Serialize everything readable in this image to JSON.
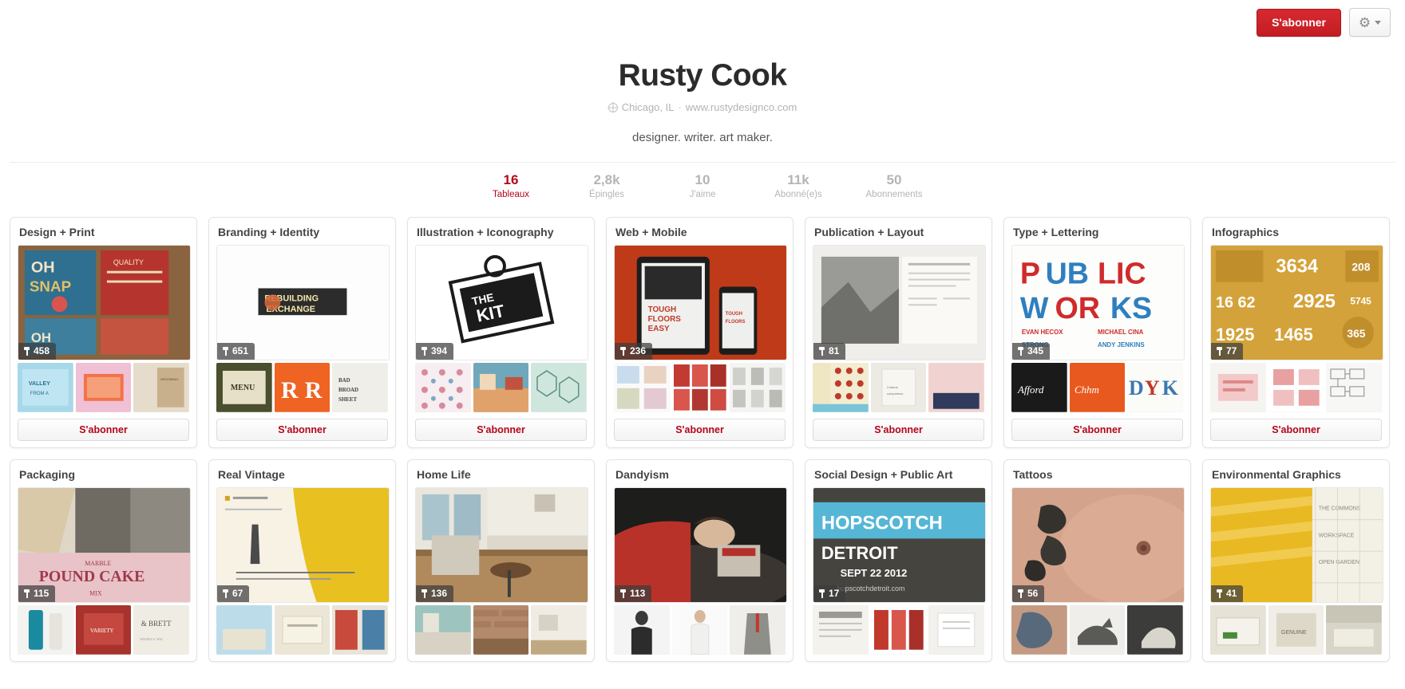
{
  "header": {
    "follow_button": "S'abonner",
    "settings_icon": "gear-icon",
    "settings_caret": "chevron-down-icon"
  },
  "profile": {
    "name": "Rusty Cook",
    "location": "Chicago, IL",
    "meta_separator": "·",
    "website": "www.rustydesignco.com",
    "bio": "designer. writer. art maker.",
    "avatar_alt": "avatar"
  },
  "stats": [
    {
      "value": "16",
      "label": "Tableaux",
      "active": true
    },
    {
      "value": "2,8k",
      "label": "Épingles",
      "active": false
    },
    {
      "value": "10",
      "label": "J'aime",
      "active": false
    },
    {
      "value": "11k",
      "label": "Abonné(e)s",
      "active": false
    },
    {
      "value": "50",
      "label": "Abonnements",
      "active": false
    }
  ],
  "board_follow_label": "S'abonner",
  "boards": [
    {
      "title": "Design + Print",
      "pins": "458",
      "cover": "poster-collage-orange",
      "thumbs": [
        "thumb-valley-blue",
        "thumb-pink-book",
        "thumb-tan-poster"
      ]
    },
    {
      "title": "Branding + Identity",
      "pins": "651",
      "cover": "rebuilding-exchange-logo",
      "thumbs": [
        "thumb-menu-dark",
        "thumb-orange-r",
        "thumb-broadsheet"
      ]
    },
    {
      "title": "Illustration + Iconography",
      "pins": "394",
      "cover": "the-kit-badge",
      "thumbs": [
        "thumb-floral-pattern",
        "thumb-interior-illo",
        "thumb-geo-mint"
      ]
    },
    {
      "title": "Web + Mobile",
      "pins": "236",
      "cover": "tablet-phone-red",
      "thumbs": [
        "thumb-ui-grid",
        "thumb-red-fashion",
        "thumb-product-grid"
      ]
    },
    {
      "title": "Publication + Layout",
      "pins": "81",
      "cover": "magazine-spread-bw",
      "thumbs": [
        "thumb-dot-grid",
        "thumb-book-cover",
        "thumb-pink-spread"
      ]
    },
    {
      "title": "Type + Lettering",
      "pins": "345",
      "cover": "public-works-type",
      "thumbs": [
        "thumb-afford-black",
        "thumb-orange-script",
        "thumb-dyk-letters"
      ]
    },
    {
      "title": "Infographics",
      "pins": "77",
      "cover": "gold-infographic-numbers",
      "thumbs": [
        "thumb-info-pink",
        "thumb-info-chart",
        "thumb-info-diagram"
      ]
    },
    {
      "title": "Packaging",
      "pins": "115",
      "cover": "pound-cake-package",
      "thumbs": [
        "thumb-teal-bottle",
        "thumb-red-tin",
        "thumb-wedding-label"
      ]
    },
    {
      "title": "Real Vintage",
      "pins": "67",
      "cover": "yellow-vintage-ad",
      "thumbs": [
        "thumb-blue-vintage",
        "thumb-cream-card",
        "thumb-retro-print"
      ]
    },
    {
      "title": "Home Life",
      "pins": "136",
      "cover": "dining-room-interior",
      "thumbs": [
        "thumb-teal-kitchen",
        "thumb-brick-room",
        "thumb-white-desk"
      ]
    },
    {
      "title": "Dandyism",
      "pins": "113",
      "cover": "man-reading-red",
      "thumbs": [
        "thumb-man-bw",
        "thumb-man-white",
        "thumb-suit-grey"
      ]
    },
    {
      "title": "Social Design + Public Art",
      "pins": "17",
      "cover": "hopscotch-detroit",
      "thumbs": [
        "thumb-poster-text",
        "thumb-red-posters",
        "thumb-white-book"
      ]
    },
    {
      "title": "Tattoos",
      "pins": "56",
      "cover": "tattoo-chest",
      "thumbs": [
        "thumb-tattoo-sleeve",
        "thumb-fox-tattoo",
        "thumb-wolf-tattoo"
      ]
    },
    {
      "title": "Environmental Graphics",
      "pins": "41",
      "cover": "yellow-stairs-signage",
      "thumbs": [
        "thumb-env-shop",
        "thumb-env-sign",
        "thumb-env-wall"
      ]
    }
  ]
}
